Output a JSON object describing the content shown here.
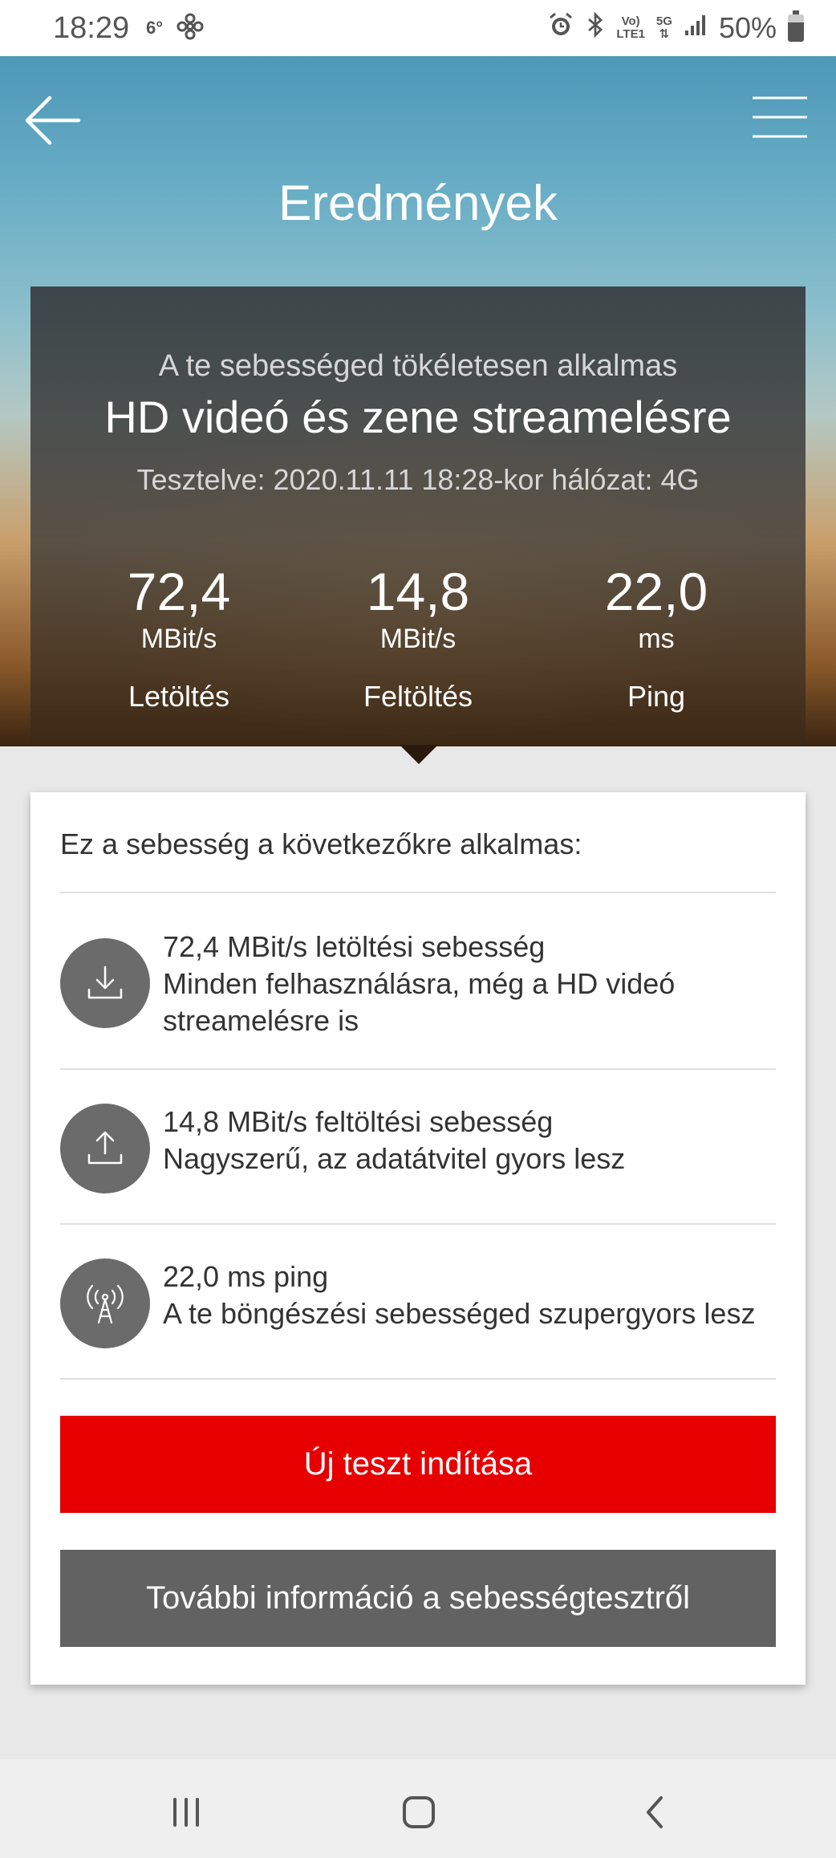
{
  "status_bar": {
    "time": "18:29",
    "temperature": "6°",
    "voice_lte_top": "Vo)",
    "voice_lte_bottom": "LTE1",
    "network_5g": "5G",
    "battery": "50%"
  },
  "header": {
    "title": "Eredmények"
  },
  "summary": {
    "subtitle": "A te sebességed tökéletesen alkalmas",
    "headline": "HD videó és zene streamelésre",
    "tested": "Tesztelve: 2020.11.11   18:28-kor hálózat: 4G"
  },
  "metrics": [
    {
      "value": "72,4",
      "unit": "MBit/s",
      "label": "Letöltés"
    },
    {
      "value": "14,8",
      "unit": "MBit/s",
      "label": "Feltöltés"
    },
    {
      "value": "22,0",
      "unit": "ms",
      "label": "Ping"
    }
  ],
  "details": {
    "intro": "Ez a sebesség a következőkre alkalmas:",
    "items": [
      {
        "icon": "download-icon",
        "line1": "72,4 MBit/s letöltési sebesség",
        "line2": "Minden felhasználásra, még a HD videó",
        "line3": "streamelésre is"
      },
      {
        "icon": "upload-icon",
        "line1": "14,8 MBit/s feltöltési sebesség",
        "line2": "Nagyszerű, az adatátvitel gyors lesz"
      },
      {
        "icon": "antenna-icon",
        "line1": "22,0 ms ping",
        "line2": "A te böngészési sebességed szupergyors lesz"
      }
    ]
  },
  "buttons": {
    "new_test": "Új teszt indítása",
    "more_info": "További információ a sebességtesztről"
  },
  "colors": {
    "accent_red": "#e60000",
    "grey_button": "#626262",
    "icon_circle": "#6b6b6b"
  }
}
